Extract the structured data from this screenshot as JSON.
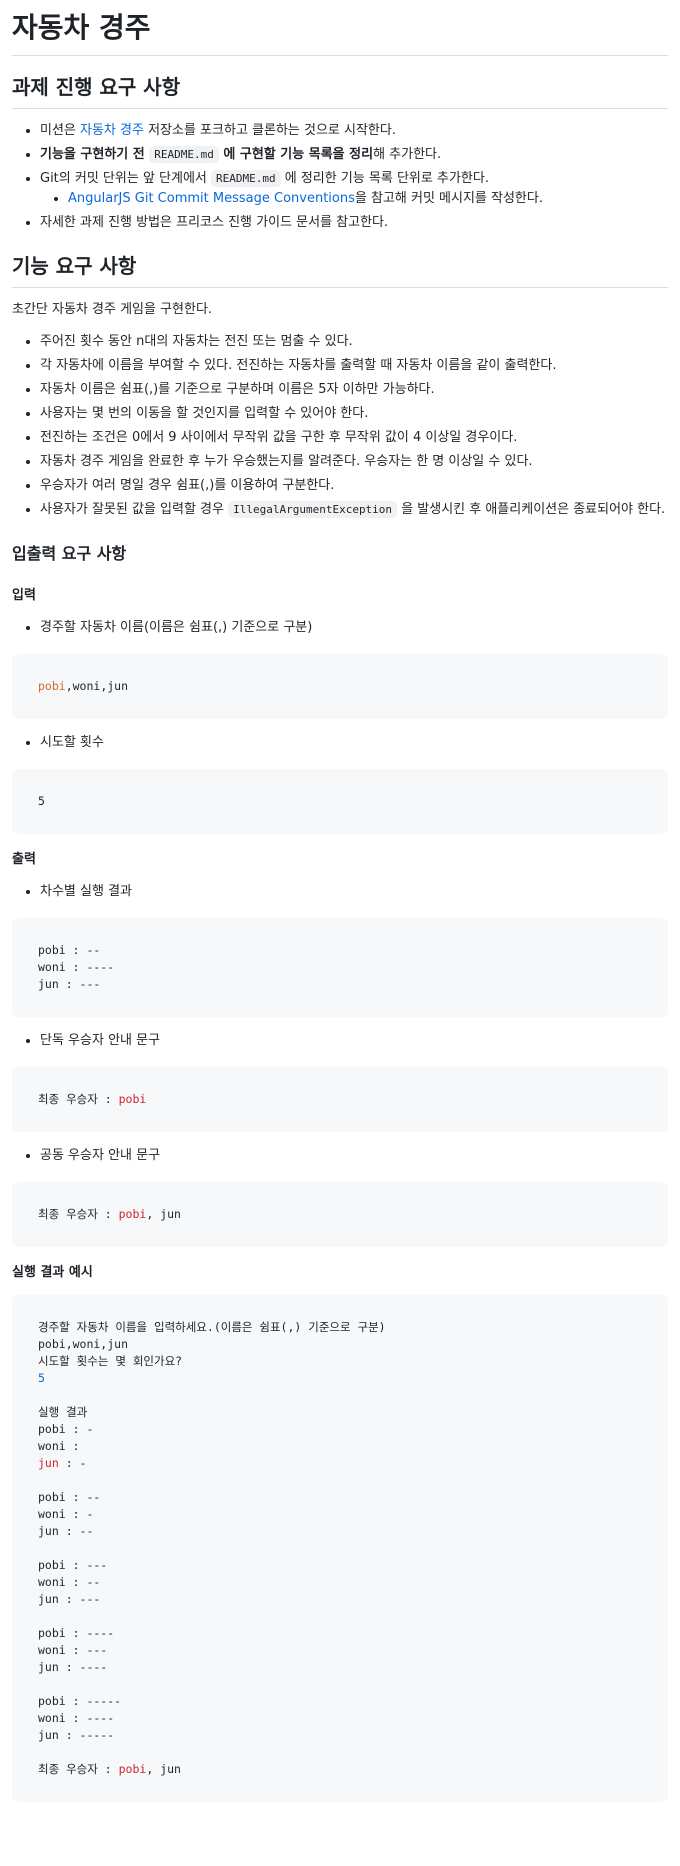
{
  "title": "자동차 경주",
  "section_progress": {
    "heading": "과제 진행 요구 사항",
    "items": [
      {
        "pre": "미션은 ",
        "link": "자동차 경주",
        "post": " 저장소를 포크하고 클론하는 것으로 시작한다."
      },
      {
        "bold1": "기능을 구현하기 전 ",
        "code": "README.md",
        "bold2": " 에 구현할 기능 목록을 정리",
        "post": "해 추가한다."
      },
      {
        "pre": "Git의 커밋 단위는 앞 단계에서 ",
        "code": "README.md",
        "post": " 에 정리한 기능 목록 단위로 추가한다.",
        "sub": {
          "link": "AngularJS Git Commit Message Conventions",
          "post": "을 참고해 커밋 메시지를 작성한다."
        }
      },
      {
        "text": "자세한 과제 진행 방법은 프리코스 진행 가이드 문서를 참고한다."
      }
    ]
  },
  "section_features": {
    "heading": "기능 요구 사항",
    "intro": "초간단 자동차 경주 게임을 구현한다.",
    "items": [
      "주어진 횟수 동안 n대의 자동차는 전진 또는 멈출 수 있다.",
      "각 자동차에 이름을 부여할 수 있다. 전진하는 자동차를 출력할 때 자동차 이름을 같이 출력한다.",
      "자동차 이름은 쉼표(,)를 기준으로 구분하며 이름은 5자 이하만 가능하다.",
      "사용자는 몇 번의 이동을 할 것인지를 입력할 수 있어야 한다.",
      "전진하는 조건은 0에서 9 사이에서 무작위 값을 구한 후 무작위 값이 4 이상일 경우이다.",
      "자동차 경주 게임을 완료한 후 누가 우승했는지를 알려준다. 우승자는 한 명 이상일 수 있다.",
      "우승자가 여러 명일 경우 쉼표(,)를 이용하여 구분한다."
    ],
    "last_item": {
      "pre": "사용자가 잘못된 값을 입력할 경우 ",
      "code": "IllegalArgumentException",
      "post": " 을 발생시킨 후 애플리케이션은 종료되어야 한다."
    }
  },
  "section_io": {
    "heading": "입출력 요구 사항",
    "input_heading": "입력",
    "input_item1": "경주할 자동차 이름(이름은 쉼표(,) 기준으로 구분)",
    "input_code1_a": "pobi",
    "input_code1_b": ",woni,jun",
    "input_item2": "시도할 횟수",
    "input_code2": "5",
    "output_heading": "출력",
    "output_item1": "차수별 실행 결과",
    "output_code1": "pobi : --\nwoni : ----\njun : ---",
    "output_item2": "단독 우승자 안내 문구",
    "output_code2_label": "최종 우승자 : ",
    "output_code2_name": "pobi",
    "output_item3": "공동 우승자 안내 문구",
    "output_code3_label": "최종 우승자 : ",
    "output_code3_name": "pobi",
    "output_code3_rest": ", jun",
    "example_heading": "실행 결과 예시",
    "example_line1": "경주할 자동차 이름을 입력하세요.(이름은 쉼표(,) 기준으로 구분)",
    "example_line2": "pobi,woni,jun",
    "example_line3": "시도할 횟수는 몇 회인가요?",
    "example_line4": "5",
    "example_line5": "실행 결과",
    "example_round1_a": "pobi : -\nwoni : ",
    "example_round1_jun": "jun",
    "example_round1_b": " : -",
    "example_rounds": "pobi : --\nwoni : -\njun : --\n\npobi : ---\nwoni : --\njun : ---\n\npobi : ----\nwoni : ---\njun : ----\n\npobi : -----\nwoni : ----\njun : -----",
    "example_final_label": "최종 우승자 : ",
    "example_final_name": "pobi",
    "example_final_rest": ", jun"
  }
}
